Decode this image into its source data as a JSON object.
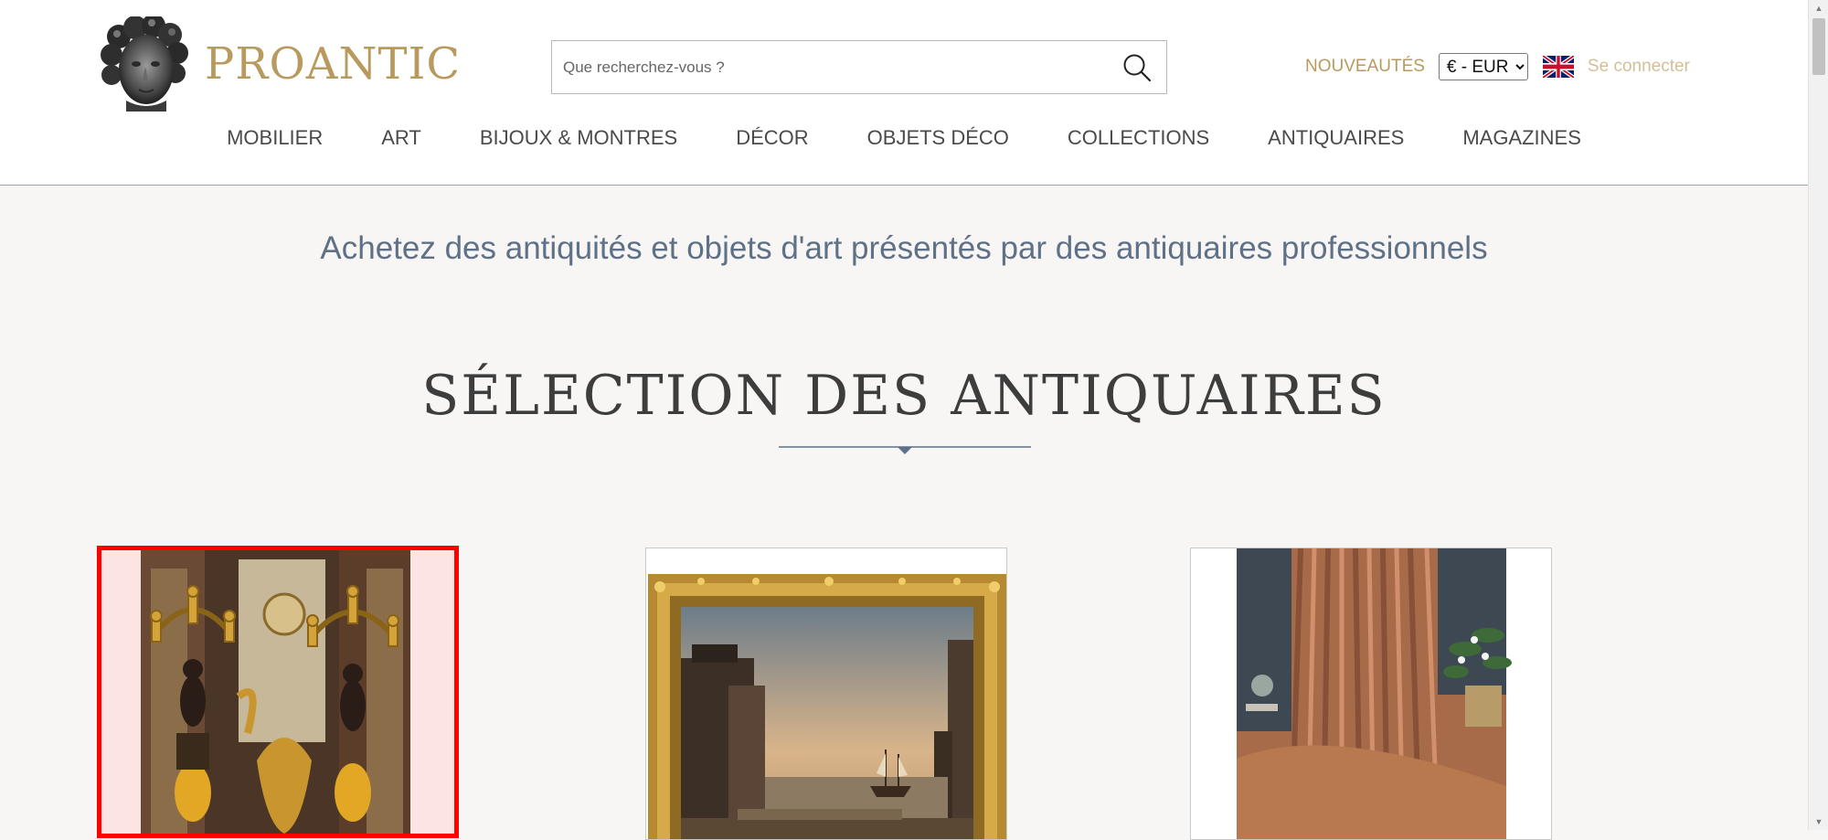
{
  "header": {
    "logo_text": "PROANTIC",
    "search": {
      "placeholder": "Que recherchez-vous ?",
      "value": ""
    },
    "nouveautes_label": "NOUVEAUTÉS",
    "currency": {
      "selected": "€ - EUR"
    },
    "language_flag": "uk-flag-icon",
    "login_label": "Se connecter",
    "colors": {
      "gold": "#b99a5e",
      "light_gold": "#d2bf97",
      "nav_text": "#4a4a4a"
    }
  },
  "nav": {
    "items": [
      {
        "label": "MOBILIER"
      },
      {
        "label": "ART"
      },
      {
        "label": "BIJOUX & MONTRES"
      },
      {
        "label": "DÉCOR"
      },
      {
        "label": "OBJETS DÉCO"
      },
      {
        "label": "COLLECTIONS"
      },
      {
        "label": "ANTIQUAIRES"
      },
      {
        "label": "MAGAZINES"
      }
    ]
  },
  "main": {
    "tagline": "Achetez des antiquités et objets d'art présentés par des antiquaires professionnels",
    "section_title": "SÉLECTION DES ANTIQUAIRES",
    "cards": [
      {
        "image": "gilt-bronze-candelabra-pair",
        "selected": true
      },
      {
        "image": "gilt-framed-harbour-painting",
        "selected": false
      },
      {
        "image": "silk-curtains",
        "selected": false
      }
    ],
    "colors": {
      "tagline": "#5f7186",
      "divider": "#5f7186",
      "selection_outline": "#ff0000"
    }
  }
}
